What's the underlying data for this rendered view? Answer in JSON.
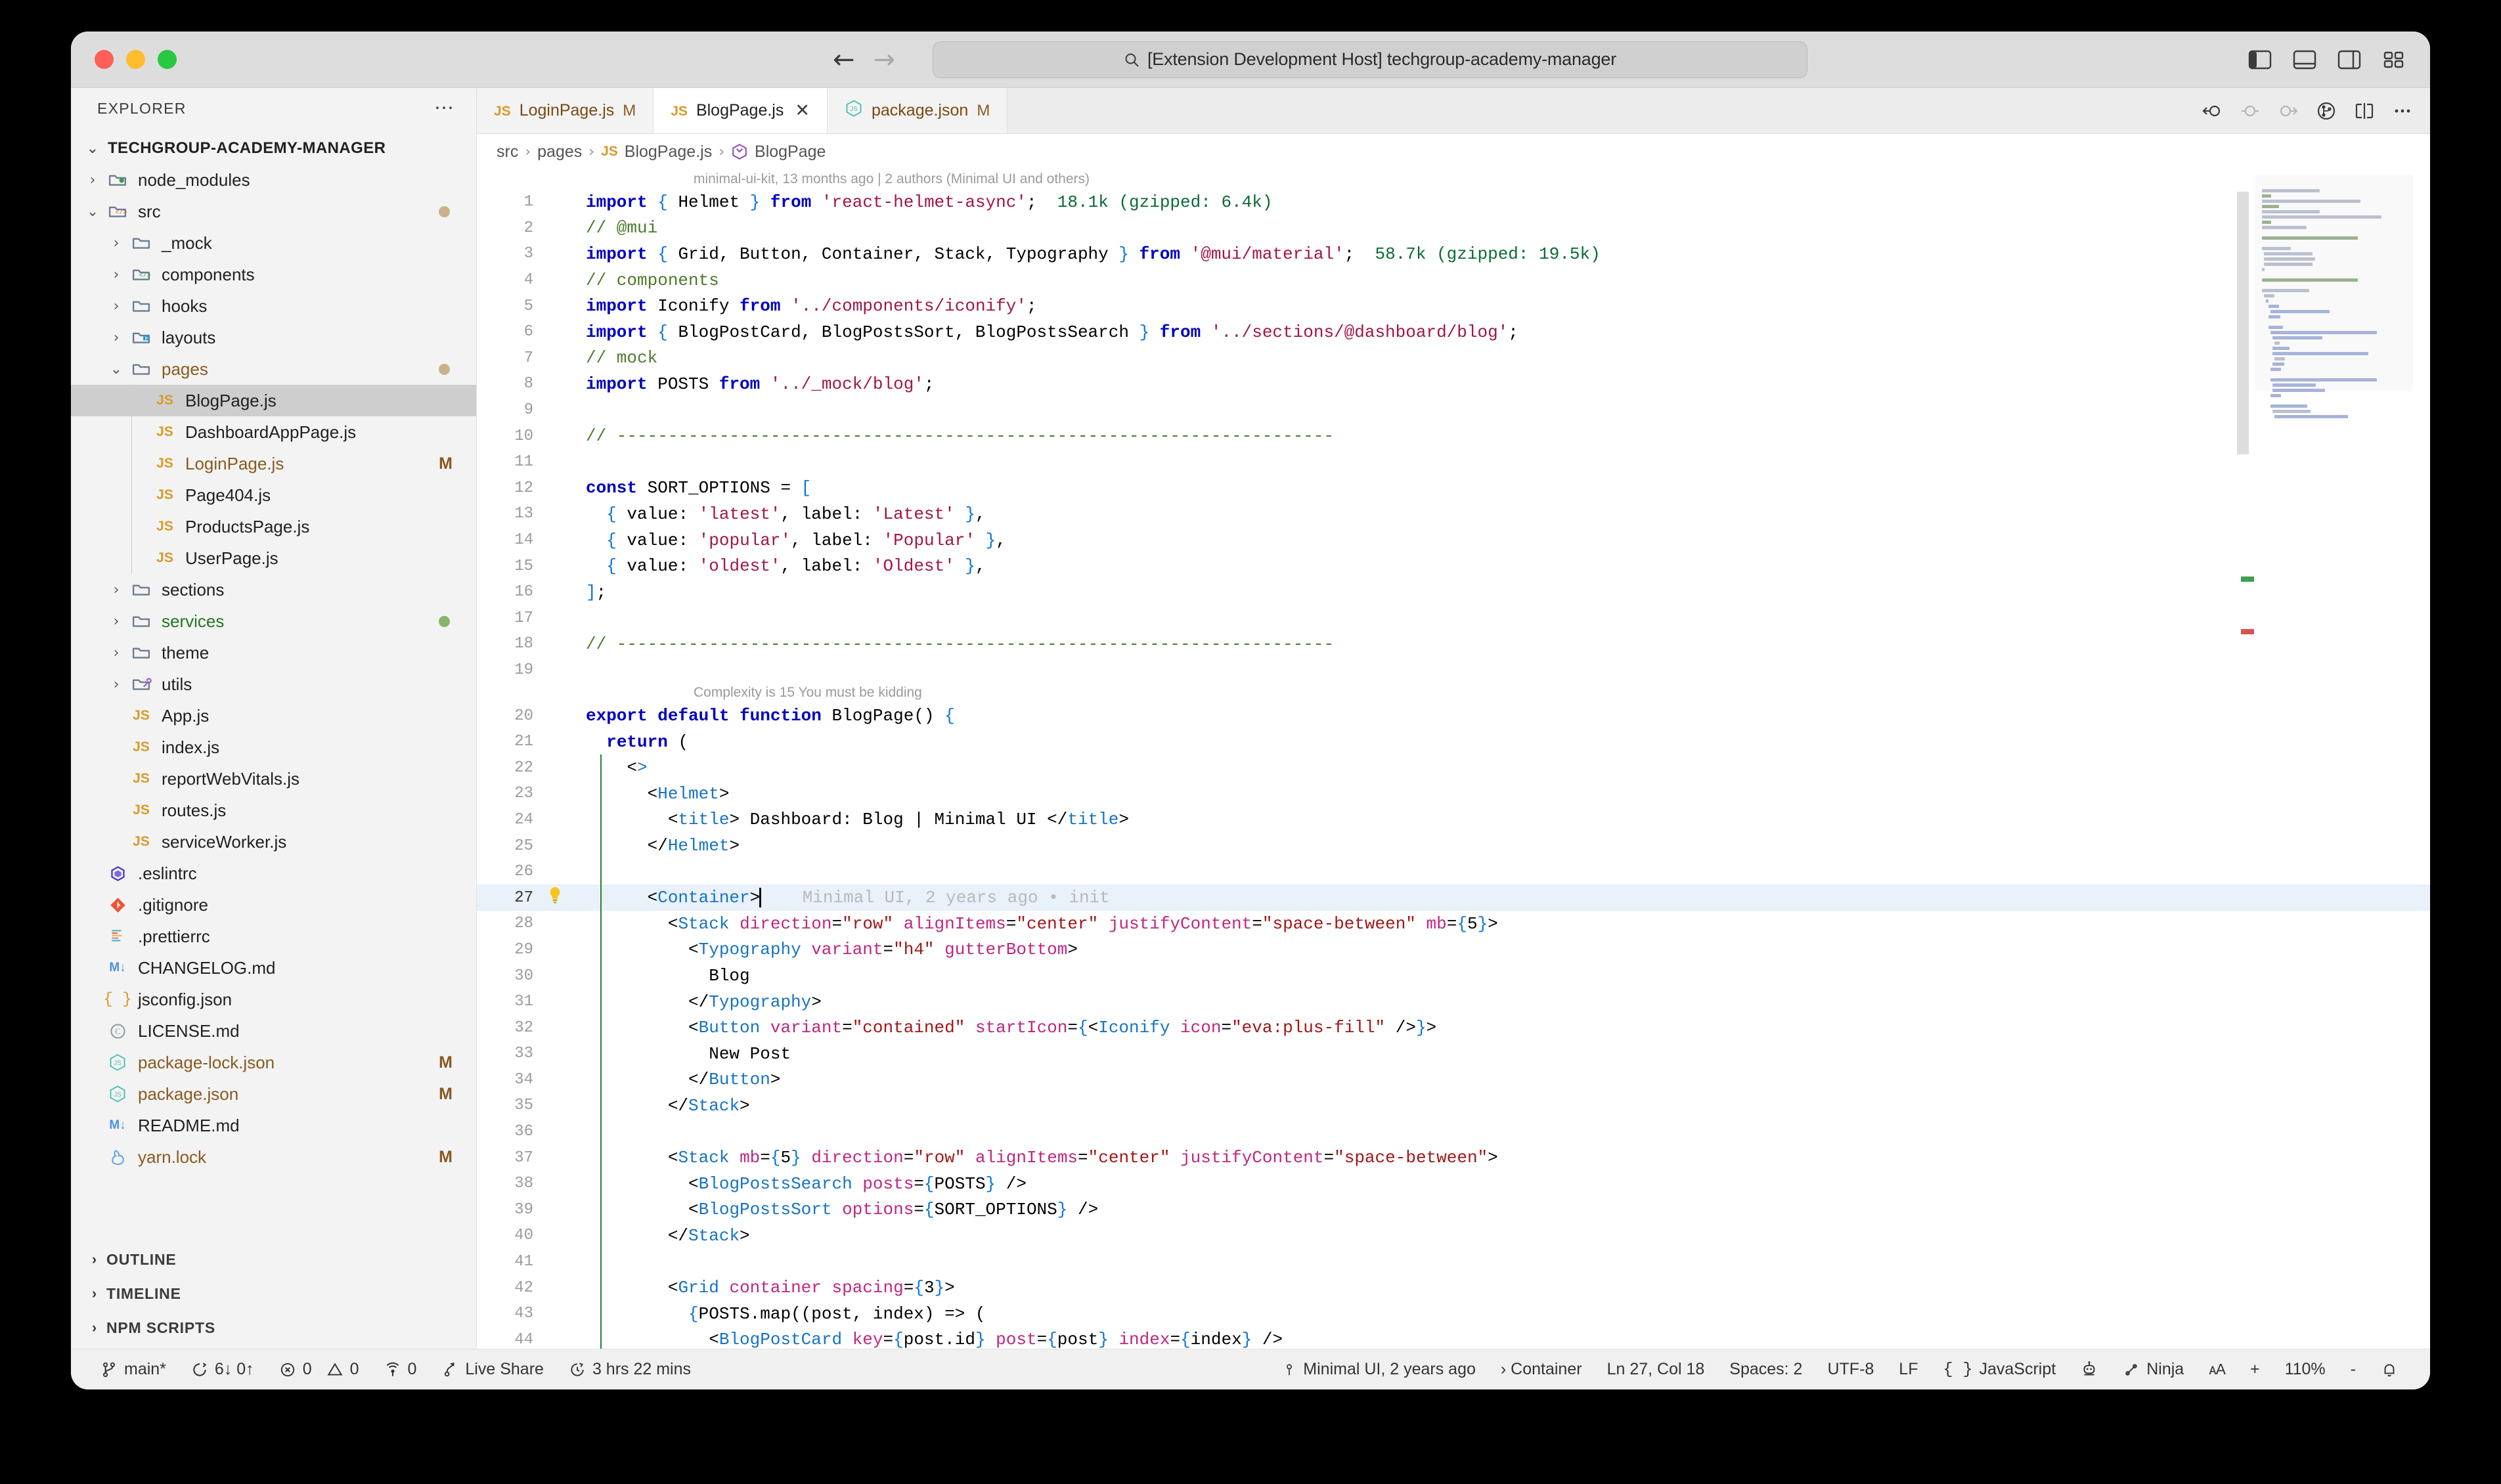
{
  "window": {
    "omnibox_text": "[Extension Development Host] techgroup-academy-manager",
    "search_icon": "search-icon"
  },
  "sidebar": {
    "header_title": "EXPLORER",
    "root_label": "TECHGROUP-ACADEMY-MANAGER",
    "tree": [
      {
        "label": "node_modules",
        "depth": 1,
        "type": "folder",
        "icon": "folder-node-icon",
        "expanded": false,
        "git": "",
        "dot": ""
      },
      {
        "label": "src",
        "depth": 1,
        "type": "folder",
        "icon": "folder-src-icon",
        "expanded": true,
        "git": "",
        "dot": "#c9b28b"
      },
      {
        "label": "_mock",
        "depth": 2,
        "type": "folder",
        "icon": "folder-icon",
        "expanded": false,
        "git": "",
        "dot": ""
      },
      {
        "label": "components",
        "depth": 2,
        "type": "folder",
        "icon": "folder-components-icon",
        "expanded": false,
        "git": "",
        "dot": ""
      },
      {
        "label": "hooks",
        "depth": 2,
        "type": "folder",
        "icon": "folder-icon",
        "expanded": false,
        "git": "",
        "dot": ""
      },
      {
        "label": "layouts",
        "depth": 2,
        "type": "folder",
        "icon": "folder-layout-icon",
        "expanded": false,
        "git": "",
        "dot": ""
      },
      {
        "label": "pages",
        "depth": 2,
        "type": "folder",
        "icon": "folder-icon",
        "expanded": true,
        "git": "",
        "dot": "#c9b28b",
        "modified": true
      },
      {
        "label": "BlogPage.js",
        "depth": 3,
        "type": "file",
        "icon": "js-icon",
        "selected": true,
        "git": "",
        "dot": ""
      },
      {
        "label": "DashboardAppPage.js",
        "depth": 3,
        "type": "file",
        "icon": "js-icon",
        "git": "",
        "dot": ""
      },
      {
        "label": "LoginPage.js",
        "depth": 3,
        "type": "file",
        "icon": "js-icon",
        "git": "M",
        "dot": "",
        "modified": true
      },
      {
        "label": "Page404.js",
        "depth": 3,
        "type": "file",
        "icon": "js-icon",
        "git": "",
        "dot": ""
      },
      {
        "label": "ProductsPage.js",
        "depth": 3,
        "type": "file",
        "icon": "js-icon",
        "git": "",
        "dot": ""
      },
      {
        "label": "UserPage.js",
        "depth": 3,
        "type": "file",
        "icon": "js-icon",
        "git": "",
        "dot": ""
      },
      {
        "label": "sections",
        "depth": 2,
        "type": "folder",
        "icon": "folder-icon",
        "expanded": false,
        "git": "",
        "dot": ""
      },
      {
        "label": "services",
        "depth": 2,
        "type": "folder",
        "icon": "folder-icon",
        "expanded": false,
        "git": "",
        "dot": "#86b56a",
        "added": true
      },
      {
        "label": "theme",
        "depth": 2,
        "type": "folder",
        "icon": "folder-icon",
        "expanded": false,
        "git": "",
        "dot": ""
      },
      {
        "label": "utils",
        "depth": 2,
        "type": "folder",
        "icon": "folder-utils-icon",
        "expanded": false,
        "git": "",
        "dot": ""
      },
      {
        "label": "App.js",
        "depth": 2,
        "type": "file",
        "icon": "js-icon",
        "git": "",
        "dot": ""
      },
      {
        "label": "index.js",
        "depth": 2,
        "type": "file",
        "icon": "js-icon",
        "git": "",
        "dot": ""
      },
      {
        "label": "reportWebVitals.js",
        "depth": 2,
        "type": "file",
        "icon": "js-icon",
        "git": "",
        "dot": ""
      },
      {
        "label": "routes.js",
        "depth": 2,
        "type": "file",
        "icon": "js-icon",
        "git": "",
        "dot": ""
      },
      {
        "label": "serviceWorker.js",
        "depth": 2,
        "type": "file",
        "icon": "js-icon",
        "git": "",
        "dot": ""
      },
      {
        "label": ".eslintrc",
        "depth": 1,
        "type": "file",
        "icon": "eslint-icon",
        "git": "",
        "dot": ""
      },
      {
        "label": ".gitignore",
        "depth": 1,
        "type": "file",
        "icon": "git-icon",
        "git": "",
        "dot": ""
      },
      {
        "label": ".prettierrc",
        "depth": 1,
        "type": "file",
        "icon": "prettier-icon",
        "git": "",
        "dot": ""
      },
      {
        "label": "CHANGELOG.md",
        "depth": 1,
        "type": "file",
        "icon": "markdown-icon",
        "git": "",
        "dot": ""
      },
      {
        "label": "jsconfig.json",
        "depth": 1,
        "type": "file",
        "icon": "json-icon",
        "git": "",
        "dot": ""
      },
      {
        "label": "LICENSE.md",
        "depth": 1,
        "type": "file",
        "icon": "license-icon",
        "git": "",
        "dot": ""
      },
      {
        "label": "package-lock.json",
        "depth": 1,
        "type": "file",
        "icon": "npm-icon",
        "git": "M",
        "dot": "",
        "modified": true
      },
      {
        "label": "package.json",
        "depth": 1,
        "type": "file",
        "icon": "npm-icon",
        "git": "M",
        "dot": "",
        "modified": true
      },
      {
        "label": "README.md",
        "depth": 1,
        "type": "file",
        "icon": "markdown-icon",
        "git": "",
        "dot": ""
      },
      {
        "label": "yarn.lock",
        "depth": 1,
        "type": "file",
        "icon": "yarn-icon",
        "git": "M",
        "dot": "",
        "modified": true
      }
    ],
    "sections": [
      {
        "label": "OUTLINE"
      },
      {
        "label": "TIMELINE"
      },
      {
        "label": "NPM SCRIPTS"
      }
    ]
  },
  "tabs": [
    {
      "label": "LoginPage.js",
      "icon": "js-icon",
      "badge": "M",
      "active": false,
      "closable": false
    },
    {
      "label": "BlogPage.js",
      "icon": "js-icon",
      "badge": "",
      "active": true,
      "closable": true,
      "close_icon": "close-icon"
    },
    {
      "label": "package.json",
      "icon": "npm-icon",
      "badge": "M",
      "active": false,
      "closable": false
    }
  ],
  "tab_actions": [
    {
      "name": "go-back-icon"
    },
    {
      "name": "no-change-icon"
    },
    {
      "name": "go-forward-icon"
    },
    {
      "name": "source-control-icon"
    },
    {
      "name": "split-editor-icon"
    },
    {
      "name": "more-actions-icon"
    }
  ],
  "breadcrumb": [
    "src",
    "pages",
    "BlogPage.js",
    "BlogPage"
  ],
  "editor": {
    "codelens_top": "minimal-ui-kit, 13 months ago | 2 authors (Minimal UI and others)",
    "codelens_complexity": "Complexity is 15 You must be kidding",
    "blame_annotation": "Minimal UI, 2 years ago • init",
    "import_size_line1": "18.1k (gzipped: 6.4k)",
    "import_size_line3": "58.7k (gzipped: 19.5k)",
    "lines": [
      {
        "n": 1,
        "text": "import { Helmet } from 'react-helmet-async';"
      },
      {
        "n": 2,
        "text": "// @mui"
      },
      {
        "n": 3,
        "text": "import { Grid, Button, Container, Stack, Typography } from '@mui/material';"
      },
      {
        "n": 4,
        "text": "// components"
      },
      {
        "n": 5,
        "text": "import Iconify from '../components/iconify';"
      },
      {
        "n": 6,
        "text": "import { BlogPostCard, BlogPostsSort, BlogPostsSearch } from '../sections/@dashboard/blog';"
      },
      {
        "n": 7,
        "text": "// mock"
      },
      {
        "n": 8,
        "text": "import POSTS from '../_mock/blog';"
      },
      {
        "n": 9,
        "text": ""
      },
      {
        "n": 10,
        "text": "// ----------------------------------------------------------------------"
      },
      {
        "n": 11,
        "text": ""
      },
      {
        "n": 12,
        "text": "const SORT_OPTIONS = ["
      },
      {
        "n": 13,
        "text": "  { value: 'latest', label: 'Latest' },"
      },
      {
        "n": 14,
        "text": "  { value: 'popular', label: 'Popular' },"
      },
      {
        "n": 15,
        "text": "  { value: 'oldest', label: 'Oldest' },"
      },
      {
        "n": 16,
        "text": "];"
      },
      {
        "n": 17,
        "text": ""
      },
      {
        "n": 18,
        "text": "// ----------------------------------------------------------------------"
      },
      {
        "n": 19,
        "text": ""
      },
      {
        "n": 20,
        "text": "export default function BlogPage() {"
      },
      {
        "n": 21,
        "text": "  return ("
      },
      {
        "n": 22,
        "text": "    <>"
      },
      {
        "n": 23,
        "text": "      <Helmet>"
      },
      {
        "n": 24,
        "text": "        <title> Dashboard: Blog | Minimal UI </title>"
      },
      {
        "n": 25,
        "text": "      </Helmet>"
      },
      {
        "n": 26,
        "text": ""
      },
      {
        "n": 27,
        "text": "      <Container>"
      },
      {
        "n": 28,
        "text": "        <Stack direction=\"row\" alignItems=\"center\" justifyContent=\"space-between\" mb={5}>"
      },
      {
        "n": 29,
        "text": "          <Typography variant=\"h4\" gutterBottom>"
      },
      {
        "n": 30,
        "text": "            Blog"
      },
      {
        "n": 31,
        "text": "          </Typography>"
      },
      {
        "n": 32,
        "text": "          <Button variant=\"contained\" startIcon={<Iconify icon=\"eva:plus-fill\" />}>"
      },
      {
        "n": 33,
        "text": "            New Post"
      },
      {
        "n": 34,
        "text": "          </Button>"
      },
      {
        "n": 35,
        "text": "        </Stack>"
      },
      {
        "n": 36,
        "text": ""
      },
      {
        "n": 37,
        "text": "        <Stack mb={5} direction=\"row\" alignItems=\"center\" justifyContent=\"space-between\">"
      },
      {
        "n": 38,
        "text": "          <BlogPostsSearch posts={POSTS} />"
      },
      {
        "n": 39,
        "text": "          <BlogPostsSort options={SORT_OPTIONS} />"
      },
      {
        "n": 40,
        "text": "        </Stack>"
      },
      {
        "n": 41,
        "text": ""
      },
      {
        "n": 42,
        "text": "        <Grid container spacing={3}>"
      },
      {
        "n": 43,
        "text": "          {POSTS.map((post, index) => ("
      },
      {
        "n": 44,
        "text": "            <BlogPostCard key={post.id} post={post} index={index} />"
      }
    ]
  },
  "statusbar": {
    "left": [
      {
        "name": "branch",
        "icon": "source-control-branch-icon",
        "label": "main*"
      },
      {
        "name": "sync",
        "icon": "sync-icon",
        "label": "6↓ 0↑"
      },
      {
        "name": "problems",
        "icon": "error-icon",
        "label": "0",
        "icon2": "warning-icon",
        "label2": "0"
      },
      {
        "name": "ports",
        "icon": "broadcast-icon",
        "label": "0"
      },
      {
        "name": "live-share",
        "icon": "live-share-icon",
        "label": "Live Share"
      },
      {
        "name": "wakatime",
        "icon": "clock-icon",
        "label": "3 hrs 22 mins"
      }
    ],
    "right": [
      {
        "name": "git-blame",
        "icon": "blame-icon",
        "label": "Minimal UI, 2 years ago"
      },
      {
        "name": "symbol-path",
        "label": "› Container"
      },
      {
        "name": "cursor-position",
        "label": "Ln 27, Col 18"
      },
      {
        "name": "indentation",
        "label": "Spaces: 2"
      },
      {
        "name": "encoding",
        "label": "UTF-8"
      },
      {
        "name": "eol",
        "label": "LF"
      },
      {
        "name": "language-mode",
        "icon": "json-brace-icon",
        "label": "JavaScript"
      },
      {
        "name": "copilot",
        "icon": "robot-icon",
        "label": ""
      },
      {
        "name": "ninja",
        "icon": "ninja-icon",
        "label": "Ninja"
      },
      {
        "name": "font-size",
        "icon": "aa-icon",
        "label": ""
      },
      {
        "name": "zoom-in",
        "label": "+"
      },
      {
        "name": "zoom-level",
        "label": "110%"
      },
      {
        "name": "zoom-out",
        "label": "-"
      },
      {
        "name": "notifications",
        "icon": "bell-icon",
        "label": ""
      }
    ]
  },
  "colors": {
    "accent_blue": "#0b74de",
    "string_red": "#a31545",
    "comment_green": "#4b7a2a",
    "jsx_tag": "#1673c4",
    "jsx_attr": "#c0267f",
    "modified_orange": "#8a5a20",
    "added_green": "#2e7d32"
  }
}
